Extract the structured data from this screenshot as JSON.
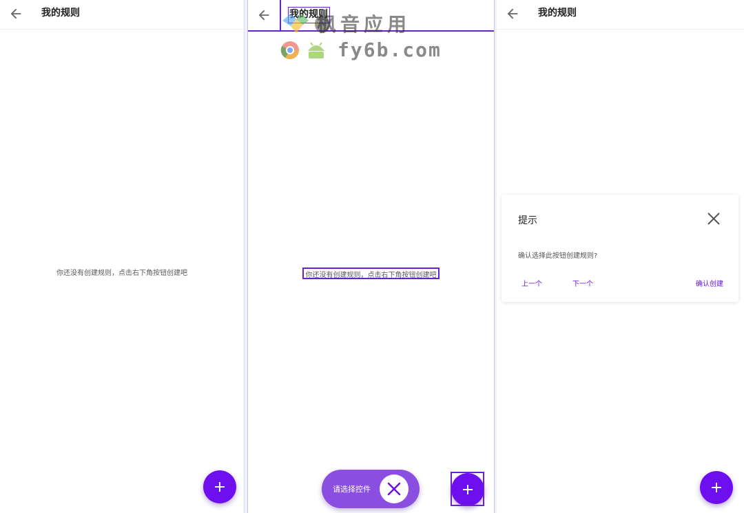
{
  "screen_left": {
    "title": "我的规则",
    "empty_text": "你还没有创建规则，点击右下角按钮创建吧",
    "fab_icon": "plus-icon"
  },
  "screen_middle": {
    "title": "我的规则",
    "empty_text": "你还没有创建规则，点击右下角按钮创建吧",
    "pick_label": "请选择控件",
    "fab_icon": "plus-icon"
  },
  "screen_right": {
    "title": "我的规则",
    "dialog": {
      "title": "提示",
      "message": "确认选择此按钮创建规则?",
      "prev": "上一个",
      "next": "下一个",
      "confirm": "确认创建"
    },
    "fab_icon": "plus-icon"
  },
  "watermark": {
    "line1": "枫音应用",
    "line2": "fy6b.com"
  },
  "colors": {
    "accent": "#6e0ff0",
    "highlight": "#6a1fd1",
    "pill": "#8a4fe0"
  }
}
